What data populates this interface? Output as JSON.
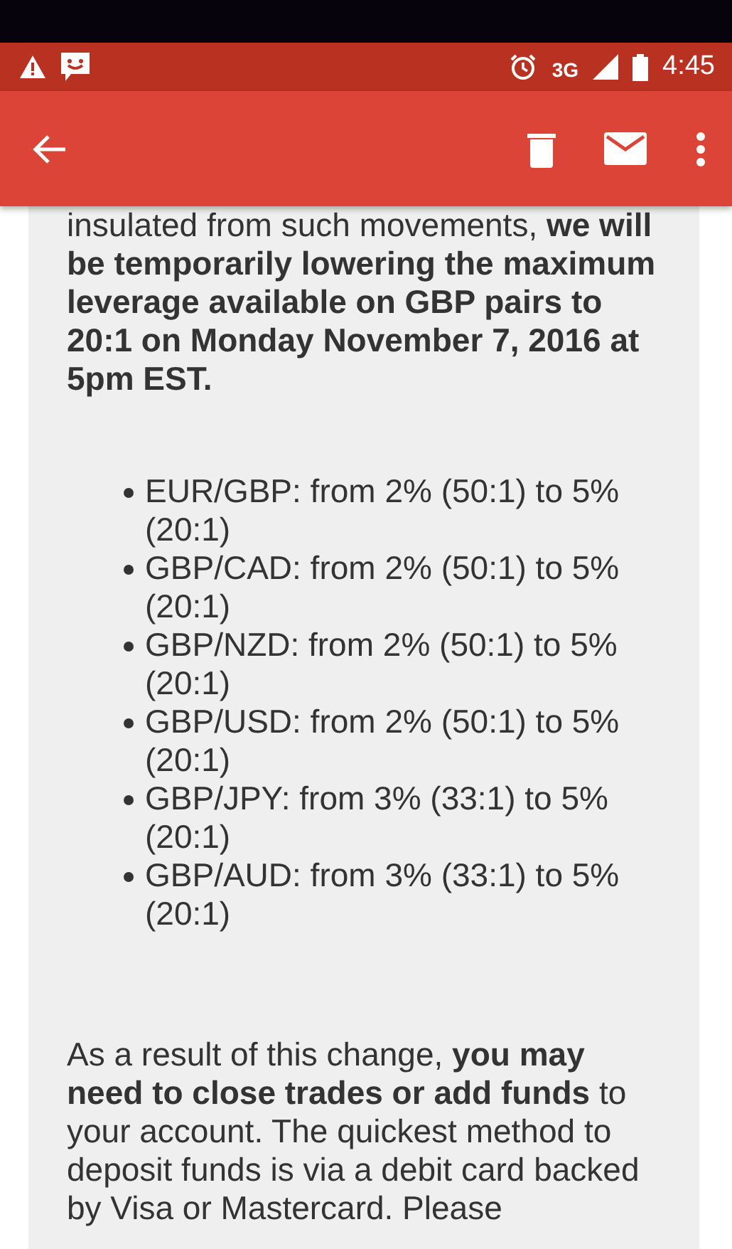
{
  "status_bar": {
    "network": "3G",
    "time": "4:45"
  },
  "body": {
    "intro": "insulated from such movements, **we will be temporarily lowering the maximum leverage available on GBP pairs to 20:1 on Monday November 7, 2016 at 5pm EST.**",
    "list": [
      "EUR/GBP: from 2% (50:1) to 5% (20:1)",
      "GBP/CAD: from 2% (50:1) to 5% (20:1)",
      "GBP/NZD: from 2% (50:1) to 5% (20:1)",
      "GBP/USD: from 2% (50:1) to 5% (20:1)",
      "GBP/JPY: from 3% (33:1) to 5% (20:1)",
      "GBP/AUD: from 3% (33:1) to 5% (20:1)"
    ],
    "outro": "As a result of this change, **you may need to close trades or add funds** to your account. The quickest method to deposit funds is via a debit card backed by Visa or Mastercard. Please"
  }
}
